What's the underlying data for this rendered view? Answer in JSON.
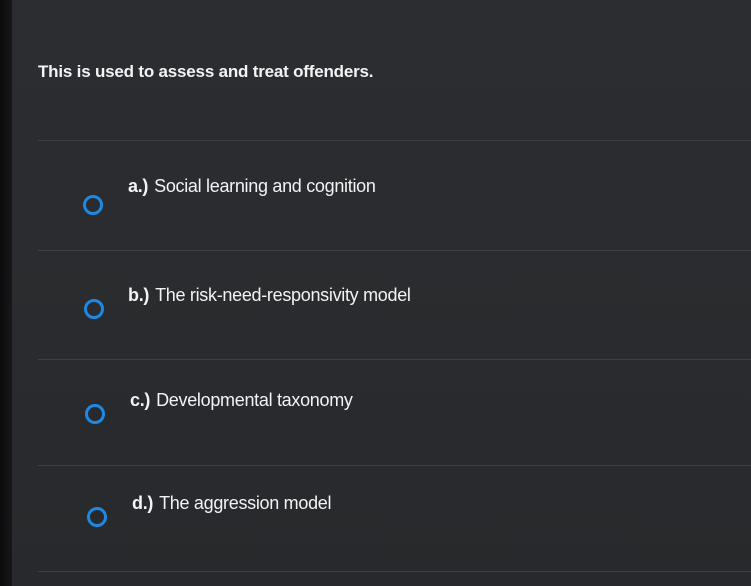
{
  "question": {
    "text": "This is used to assess and treat offenders."
  },
  "options": [
    {
      "letter": "a.)",
      "label": "Social learning and cognition",
      "selected": false
    },
    {
      "letter": "b.)",
      "label": "The risk-need-responsivity model",
      "selected": false
    },
    {
      "letter": "c.)",
      "label": "Developmental taxonomy",
      "selected": false
    },
    {
      "letter": "d.)",
      "label": "The aggression model",
      "selected": false
    }
  ],
  "colors": {
    "radio_accent": "#1e88e5",
    "background": "#2a2c2f",
    "text": "#f1f3f5"
  }
}
